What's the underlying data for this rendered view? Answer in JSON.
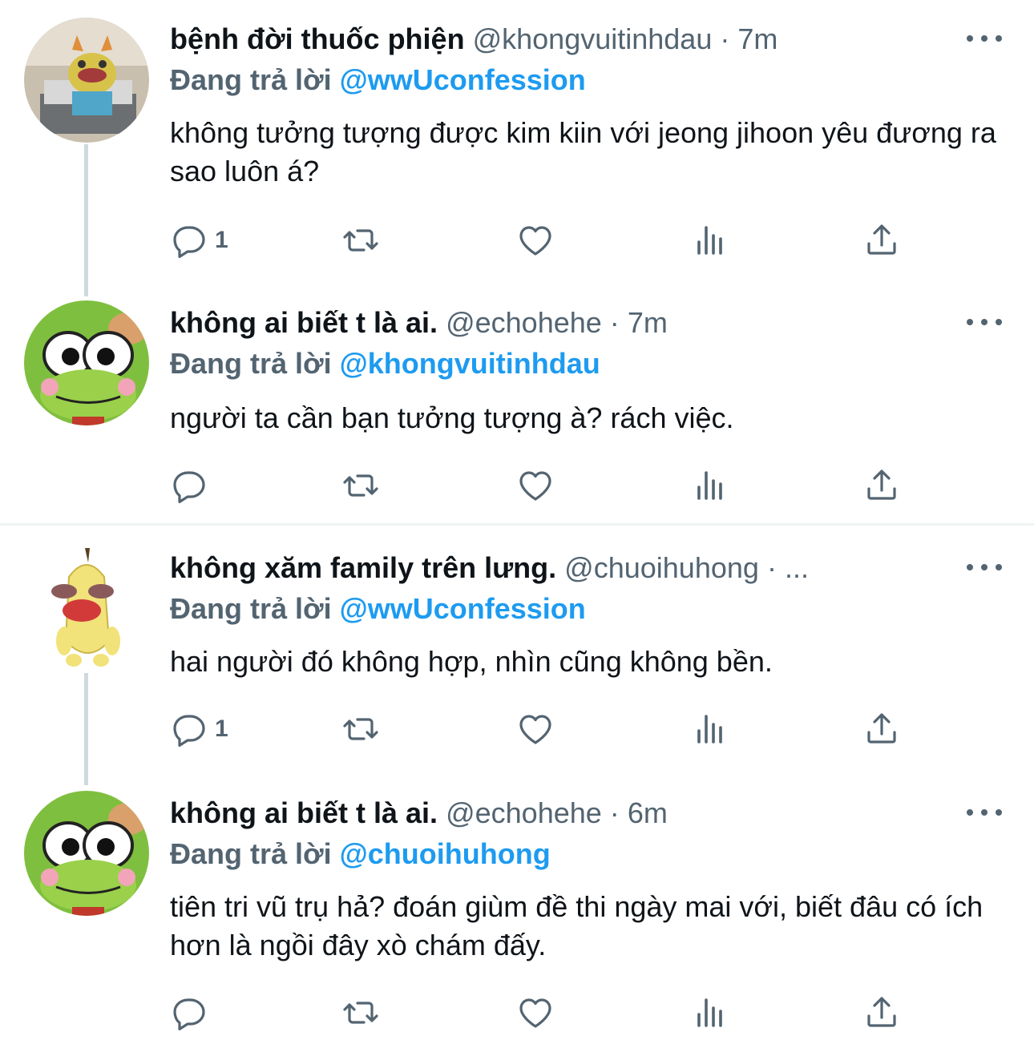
{
  "tweets": [
    {
      "display_name": "bệnh đời thuốc phiện",
      "handle": "@khongvuitinhdau",
      "sep": "·",
      "time": "7m",
      "reply_prefix": "Đang trả lời",
      "reply_to": "@wwUconfession",
      "text": "không tưởng tượng được kim kiin với jeong jihoon yêu đương ra sao luôn á?",
      "reply_count": "1"
    },
    {
      "display_name": "không ai biết t là ai.",
      "handle": "@echohehe",
      "sep": "·",
      "time": "7m",
      "reply_prefix": "Đang trả lời",
      "reply_to": "@khongvuitinhdau",
      "text": "người ta cần bạn tưởng tượng à? rách việc.",
      "reply_count": ""
    },
    {
      "display_name": "không xăm family trên lưng.",
      "handle": "@chuoihuhong",
      "sep": "·",
      "time": "...",
      "reply_prefix": "Đang trả lời",
      "reply_to": "@wwUconfession",
      "text": "hai người đó không hợp, nhìn cũng không bền.",
      "reply_count": "1"
    },
    {
      "display_name": "không ai biết t là ai.",
      "handle": "@echohehe",
      "sep": "·",
      "time": "6m",
      "reply_prefix": "Đang trả lời",
      "reply_to": "@chuoihuhong",
      "text": "tiên tri vũ trụ hả? đoán giùm đề thi ngày mai với, biết đâu có ích hơn là ngồi đây xò chám đấy.",
      "reply_count": ""
    }
  ],
  "colors": {
    "text": "#0f1419",
    "secondary": "#536471",
    "accent": "#1d9bf0",
    "thread_line": "#cfd9de",
    "divider": "#eff3f4"
  },
  "icons": [
    "reply-icon",
    "retweet-icon",
    "like-icon",
    "views-icon",
    "share-icon",
    "more-icon"
  ]
}
